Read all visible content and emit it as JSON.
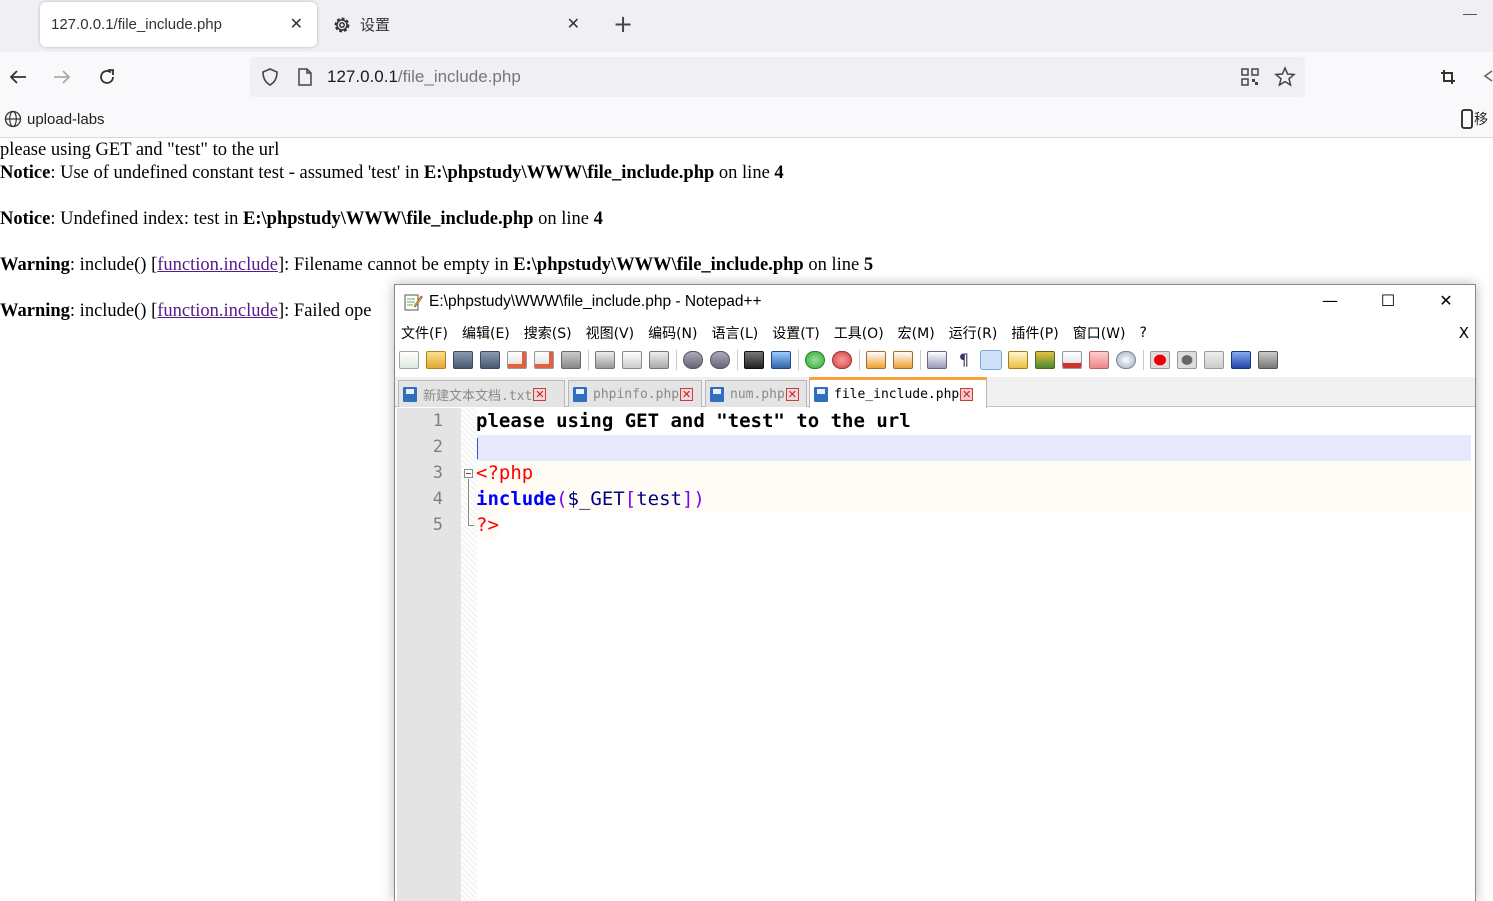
{
  "browser": {
    "tabs": [
      {
        "title": "127.0.0.1/file_include.php",
        "active": true
      },
      {
        "title": "设置",
        "active": false
      }
    ],
    "url_host": "127.0.0.1",
    "url_path": "/file_include.php",
    "bookmarks": [
      {
        "label": "upload-labs"
      }
    ],
    "bookmarks_right_label": "移"
  },
  "page": {
    "line1": "please using GET and \"test\" to the url",
    "notice1": {
      "label": "Notice",
      "text": ": Use of undefined constant test - assumed 'test' in ",
      "path": "E:\\phpstudy\\WWW\\file_include.php",
      "on_line": " on line ",
      "line": "4"
    },
    "notice2": {
      "label": "Notice",
      "text": ": Undefined index: test in ",
      "path": "E:\\phpstudy\\WWW\\file_include.php",
      "on_line": " on line ",
      "line": "4"
    },
    "warning1": {
      "label": "Warning",
      "pre": ": include() [",
      "link": "function.include",
      "post": "]: Filename cannot be empty in ",
      "path": "E:\\phpstudy\\WWW\\file_include.php",
      "on_line": " on line ",
      "line": "5"
    },
    "warning2": {
      "label": "Warning",
      "pre": ": include() [",
      "link": "function.include",
      "post": "]: Failed ope"
    }
  },
  "notepad": {
    "title": "E:\\phpstudy\\WWW\\file_include.php - Notepad++",
    "menu": [
      "文件(F)",
      "编辑(E)",
      "搜索(S)",
      "视图(V)",
      "编码(N)",
      "语言(L)",
      "设置(T)",
      "工具(O)",
      "宏(M)",
      "运行(R)",
      "插件(P)",
      "窗口(W)",
      "?"
    ],
    "menu_close": "X",
    "file_tabs": [
      {
        "name": "新建文本文档.txt",
        "active": false
      },
      {
        "name": "phpinfo.php",
        "active": false
      },
      {
        "name": "num.php",
        "active": false
      },
      {
        "name": "file_include.php",
        "active": true
      }
    ],
    "lines": [
      {
        "num": "1",
        "text": "please using GET and \"test\" to the url"
      },
      {
        "num": "2",
        "text": ""
      },
      {
        "num": "3",
        "open_tag": "<?php"
      },
      {
        "num": "4",
        "keyword": "include",
        "paren_open": "(",
        "var": "$_GET",
        "bracket_open": "[",
        "index": "test",
        "bracket_close": "]",
        "paren_close": ")"
      },
      {
        "num": "5",
        "close_tag": "?>"
      }
    ]
  }
}
